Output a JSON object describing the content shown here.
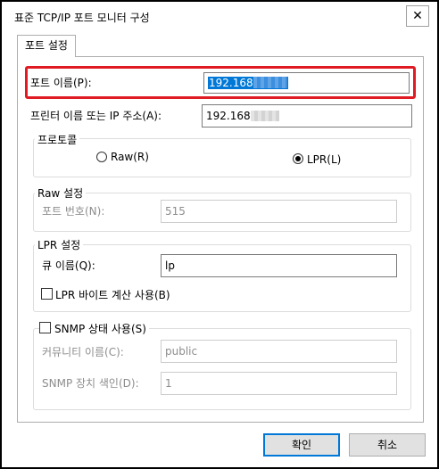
{
  "window": {
    "title": "표준 TCP/IP 포트 모니터 구성",
    "close_glyph": "✕"
  },
  "tabs": [
    {
      "label": "포트 설정"
    }
  ],
  "port_name": {
    "label": "포트 이름(P):",
    "value": "192.168"
  },
  "printer_name": {
    "label": "프린터 이름 또는 IP 주소(A):",
    "value": "192.168"
  },
  "protocol": {
    "label": "프로토콜",
    "options": [
      {
        "label": "Raw(R)",
        "checked": false
      },
      {
        "label": "LPR(L)",
        "checked": true
      }
    ]
  },
  "raw_settings": {
    "label": "Raw 설정",
    "port_number_label": "포트 번호(N):",
    "port_number_value": "515"
  },
  "lpr_settings": {
    "label": "LPR 설정",
    "queue_name_label": "큐 이름(Q):",
    "queue_name_value": "lp",
    "byte_count_label": "LPR 바이트 계산 사용(B)"
  },
  "snmp": {
    "label": "SNMP 상태 사용(S)",
    "community_label": "커뮤니티 이름(C):",
    "community_value": "public",
    "device_index_label": "SNMP 장치 색인(D):",
    "device_index_value": "1"
  },
  "buttons": {
    "ok": "확인",
    "cancel": "취소"
  },
  "colors": {
    "highlight": "#e01b24",
    "selection": "#0078d7",
    "focus": "#0078d7"
  }
}
